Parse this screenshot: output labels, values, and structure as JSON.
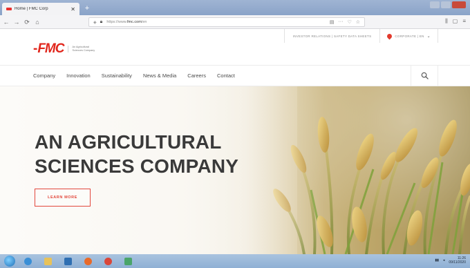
{
  "browser": {
    "tab_title": "Home | FMC Corp",
    "tab_close": "✕",
    "new_tab": "+",
    "back": "←",
    "forward": "→",
    "reload": "⟳",
    "home": "⌂",
    "url_prefix": "https://www.",
    "url_domain": "fmc.com",
    "url_suffix": "/en",
    "url_actions": [
      "▤",
      "···",
      "♡",
      "☆"
    ],
    "toolbar_icons": [
      "⫼",
      "▢",
      "≡"
    ]
  },
  "utility_bar": {
    "links": "INVESTOR RELATIONS  |  SAFETY DATA SHEETS",
    "region": "CORPORATE  |  EN",
    "chevron": "⌄"
  },
  "logo": {
    "name": "FMC",
    "tagline_line1": "An Agricultural",
    "tagline_line2": "Sciences Company"
  },
  "nav": {
    "items": [
      "Company",
      "Innovation",
      "Sustainability",
      "News & Media",
      "Careers",
      "Contact"
    ]
  },
  "hero": {
    "title_line1": "AN AGRICULTURAL",
    "title_line2": "SCIENCES COMPANY",
    "cta_label": "LEARN MORE"
  },
  "taskbar": {
    "time": "11:26",
    "date": "09/11/2020"
  },
  "colors": {
    "brand_red": "#e1261c",
    "text_dark": "#3a3a3a",
    "nav_text": "#4a4a4a"
  }
}
